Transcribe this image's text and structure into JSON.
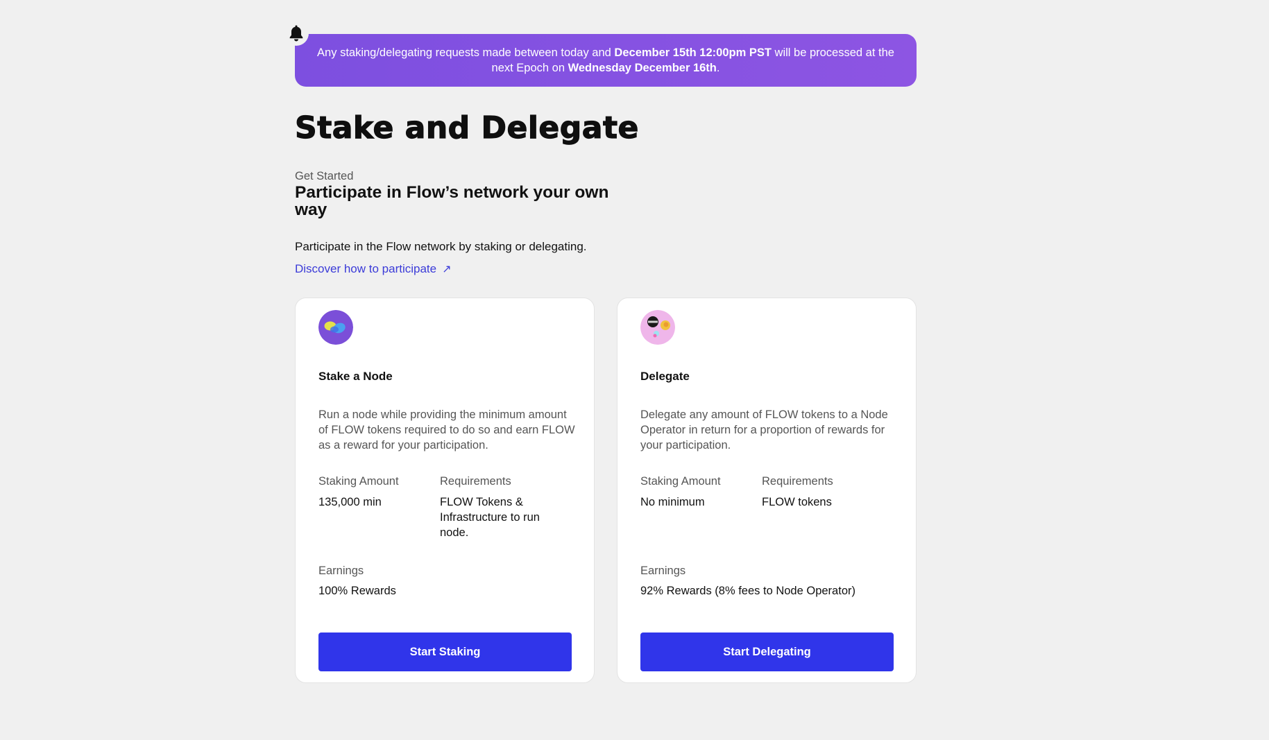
{
  "banner": {
    "text_1": "Any staking/delegating requests made between today and ",
    "bold_1": "December 15th 12:00pm PST",
    "text_2": " will be processed at the next Epoch on ",
    "bold_2": "Wednesday December 16th",
    "text_3": ".",
    "icon": "bell-icon"
  },
  "header": {
    "title": "Stake and Delegate",
    "eyebrow": "Get Started",
    "headline": "Participate in Flow’s network your own way",
    "intro": "Participate in the Flow network by staking or delegating.",
    "link_label": "Discover how to participate",
    "link_icon": "↗"
  },
  "cards": [
    {
      "title": "Stake a Node",
      "description": "Run a node while providing the minimum amount of FLOW tokens required to do so and earn FLOW as a reward for your participation.",
      "staking_amount_label": "Staking Amount",
      "staking_amount_value": "135,000 min",
      "requirements_label": "Requirements",
      "requirements_value": "FLOW Tokens & Infrastructure to run node.",
      "earnings_label": "Earnings",
      "earnings_value": "100% Rewards",
      "button_label": "Start Staking"
    },
    {
      "title": "Delegate",
      "description": "Delegate any amount of FLOW tokens to a Node Operator in return for a proportion of rewards for your participation.",
      "staking_amount_label": "Staking Amount",
      "staking_amount_value": "No minimum",
      "requirements_label": "Requirements",
      "requirements_value": "FLOW tokens",
      "earnings_label": "Earnings",
      "earnings_value": "92% Rewards (8% fees to Node Operator)",
      "button_label": "Start Delegating"
    }
  ],
  "colors": {
    "banner": "#8b52e2",
    "button": "#3035ea",
    "link": "#3b3bd8",
    "background": "#f0f0f0"
  }
}
